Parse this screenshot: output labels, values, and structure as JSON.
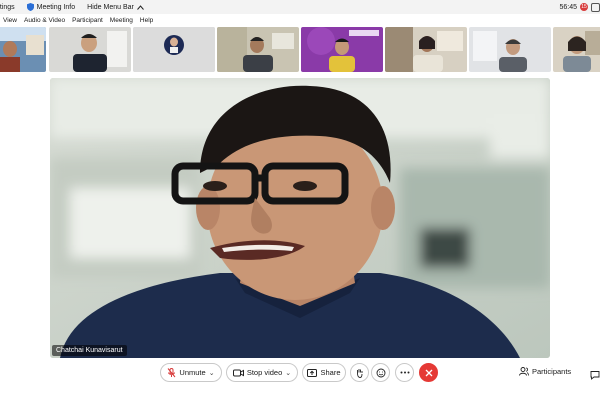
{
  "topbar": {
    "settings_label": "ettings",
    "meeting_info_label": "Meeting Info",
    "hide_menu_label": "Hide Menu Bar",
    "time": "56:45",
    "badge": "15"
  },
  "menubar": {
    "items": [
      "View",
      "Audio & Video",
      "Participant",
      "Meeting",
      "Help"
    ]
  },
  "main": {
    "speaker_name": "Chatchai Kunavisarut"
  },
  "controls": {
    "unmute_label": "Unmute",
    "stop_video_label": "Stop video",
    "share_label": "Share",
    "participants_label": "Participants"
  },
  "icons": [
    "shield-icon",
    "chevron-up-icon",
    "mic-muted-icon",
    "video-icon",
    "share-icon",
    "raise-hand-icon",
    "reaction-icon",
    "more-icon",
    "end-call-icon",
    "participants-icon",
    "chat-icon"
  ],
  "colors": {
    "leave": "#e53935",
    "mute_red": "#d83b3b",
    "accent_blue": "#2b6fd6"
  }
}
